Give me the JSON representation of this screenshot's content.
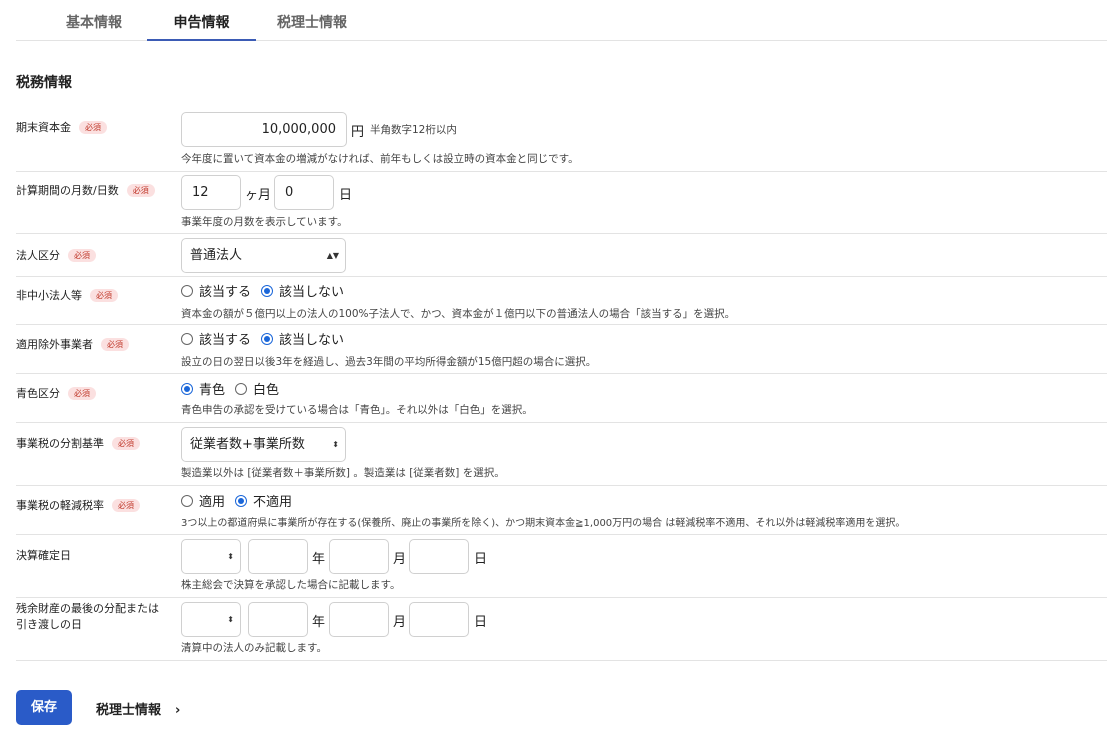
{
  "tabs": [
    {
      "label": "基本情報"
    },
    {
      "label": "申告情報"
    },
    {
      "label": "税理士情報"
    }
  ],
  "section_title": "税務情報",
  "required_badge": "必須",
  "fields": {
    "capital": {
      "label": "期末資本金",
      "value": "10,000,000",
      "unit": "円",
      "note": "半角数字12桁以内",
      "help": "今年度に置いて資本金の増減がなければ、前年もしくは設立時の資本金と同じです。"
    },
    "period": {
      "label": "計算期間の月数/日数",
      "months": "12",
      "months_unit": "ヶ月",
      "days": "0",
      "days_unit": "日",
      "help": "事業年度の月数を表示しています。"
    },
    "corp_type": {
      "label": "法人区分",
      "selected": "普通法人"
    },
    "non_sme": {
      "label": "非中小法人等",
      "options": [
        "該当する",
        "該当しない"
      ],
      "selected_index": 1,
      "help": "資本金の額が５億円以上の法人の100%子法人で、かつ、資本金が１億円以下の普通法人の場合「該当する」を選択。"
    },
    "exempt": {
      "label": "適用除外事業者",
      "options": [
        "該当する",
        "該当しない"
      ],
      "selected_index": 1,
      "help": "設立の日の翌日以後3年を経過し、過去3年間の平均所得金額が15億円超の場合に選択。"
    },
    "blue": {
      "label": "青色区分",
      "options": [
        "青色",
        "白色"
      ],
      "selected_index": 0,
      "help": "青色申告の承認を受けている場合は「青色」。それ以外は「白色」を選択。"
    },
    "split_basis": {
      "label": "事業税の分割基準",
      "selected": "従業者数+事業所数",
      "help": "製造業以外は [従業者数＋事業所数] 。製造業は [従業者数] を選択。"
    },
    "reduced_rate": {
      "label": "事業税の軽減税率",
      "options": [
        "適用",
        "不適用"
      ],
      "selected_index": 1,
      "help": "3つ以上の都道府県に事業所が存在する(保養所、廃止の事業所を除く)、かつ期末資本金≧1,000万円の場合 は軽減税率不適用、それ以外は軽減税率適用を選択。"
    },
    "settlement_date": {
      "label": "決算確定日",
      "era": "",
      "year": "",
      "year_unit": "年",
      "month": "",
      "month_unit": "月",
      "day": "",
      "day_unit": "日",
      "help": "株主総会で決算を承認した場合に記載します。"
    },
    "distribution_date": {
      "label_line1": "残余財産の最後の分配または",
      "label_line2": "引き渡しの日",
      "era": "",
      "year": "",
      "year_unit": "年",
      "month": "",
      "month_unit": "月",
      "day": "",
      "day_unit": "日",
      "help": "清算中の法人のみ記載します。"
    }
  },
  "footer": {
    "save_label": "保存",
    "next_label": "税理士情報",
    "next_chevron": "›"
  },
  "colors": {
    "accent": "#2a5bc8",
    "radio": "#1a66d9",
    "badge_bg": "#fbe0e0",
    "badge_text": "#c0392b"
  }
}
